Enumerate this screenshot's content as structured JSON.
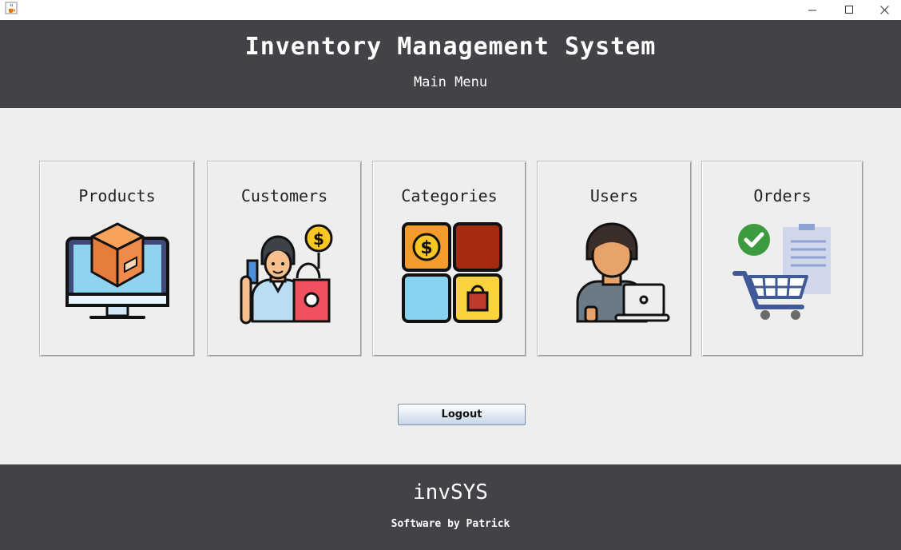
{
  "window": {
    "app_icon": "java-cup-icon",
    "controls": [
      "minimize-icon",
      "maximize-icon",
      "close-icon"
    ]
  },
  "header": {
    "title": "Inventory Management System",
    "subtitle": "Main Menu"
  },
  "menu": {
    "cards": [
      {
        "label": "Products",
        "icon": "monitor-box-icon"
      },
      {
        "label": "Customers",
        "icon": "shopper-icon"
      },
      {
        "label": "Categories",
        "icon": "category-grid-icon"
      },
      {
        "label": "Users",
        "icon": "user-laptop-icon"
      },
      {
        "label": "Orders",
        "icon": "cart-checklist-icon"
      }
    ]
  },
  "logout_label": "Logout",
  "footer": {
    "brand": "invSYS",
    "credit": "Software by Patrick"
  },
  "colors": {
    "header_bg": "#424347",
    "content_bg": "#eeeeee",
    "text_light": "#ffffff"
  }
}
